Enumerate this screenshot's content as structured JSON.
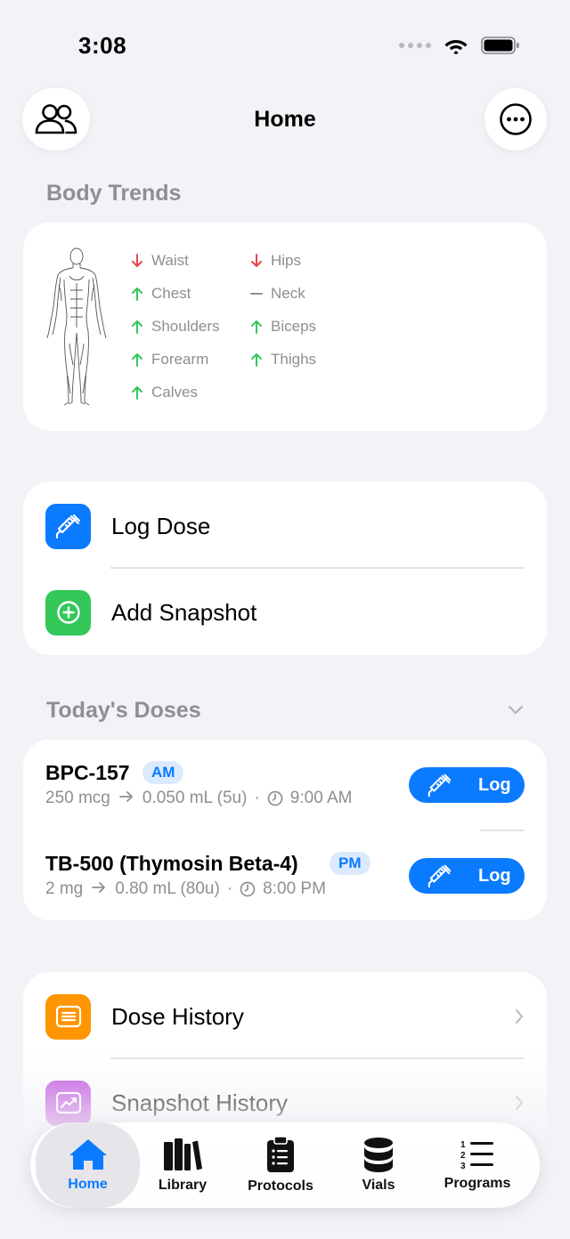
{
  "status_bar": {
    "time": "3:08"
  },
  "nav": {
    "title": "Home",
    "left_icon": "people-icon",
    "right_icon": "ellipsis-circle-icon"
  },
  "body_trends": {
    "title": "Body Trends",
    "items": [
      {
        "label": "Waist",
        "trend": "down"
      },
      {
        "label": "Hips",
        "trend": "down"
      },
      {
        "label": "Chest",
        "trend": "up"
      },
      {
        "label": "Neck",
        "trend": "flat"
      },
      {
        "label": "Shoulders",
        "trend": "up"
      },
      {
        "label": "Biceps",
        "trend": "up"
      },
      {
        "label": "Forearm",
        "trend": "up"
      },
      {
        "label": "Thighs",
        "trend": "up"
      },
      {
        "label": "Calves",
        "trend": "up"
      }
    ]
  },
  "quick_actions": {
    "log_dose": "Log Dose",
    "add_snapshot": "Add Snapshot"
  },
  "todays_doses": {
    "title": "Today's Doses",
    "doses": [
      {
        "name": "BPC-157",
        "time_of_day": "AM",
        "amount": "250 mcg",
        "volume": "0.050 mL (5u)",
        "time": "9:00 AM",
        "button": "Log"
      },
      {
        "name": "TB-500 (Thymosin Beta-4)",
        "time_of_day": "PM",
        "amount": "2 mg",
        "volume": "0.80 mL (80u)",
        "time": "8:00 PM",
        "button": "Log"
      }
    ]
  },
  "history": {
    "dose_history": "Dose History",
    "snapshot_history": "Snapshot History"
  },
  "tab_bar": {
    "tabs": [
      {
        "label": "Home",
        "icon": "house-icon",
        "active": true
      },
      {
        "label": "Library",
        "icon": "books-icon",
        "active": false
      },
      {
        "label": "Protocols",
        "icon": "clipboard-icon",
        "active": false
      },
      {
        "label": "Vials",
        "icon": "cylinder-icon",
        "active": false
      },
      {
        "label": "Programs",
        "icon": "numbered-list-icon",
        "active": false
      }
    ]
  },
  "colors": {
    "background": "#f2f2f7",
    "accent_blue": "#0a7aff",
    "green": "#34c759",
    "orange": "#ff9500",
    "purple": "#c04fe0",
    "trend_up": "#34c759",
    "trend_down": "#e5484d",
    "secondary_text": "#8e8e93"
  }
}
